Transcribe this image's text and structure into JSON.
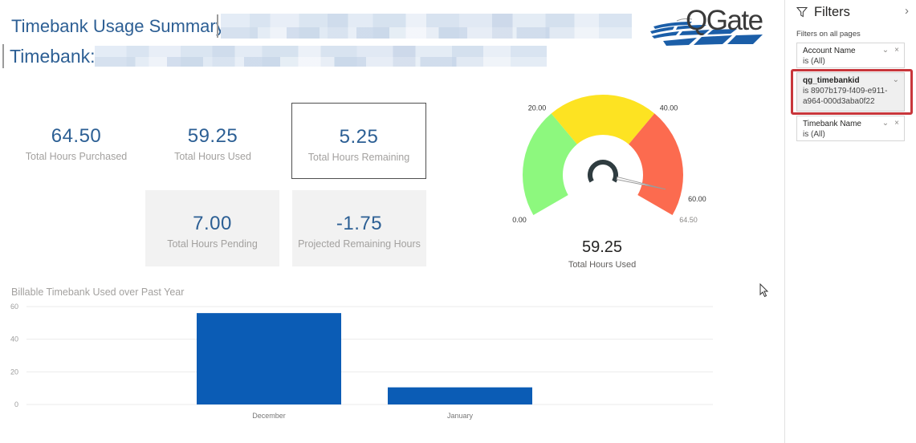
{
  "header": {
    "title": "Timebank Usage Summary",
    "timebank_label": "Timebank:",
    "logo_text": "QGate",
    "accent_color": "#2d5f94"
  },
  "kpis": [
    {
      "value": "64.50",
      "label": "Total Hours Purchased"
    },
    {
      "value": "59.25",
      "label": "Total Hours Used"
    },
    {
      "value": "5.25",
      "label": "Total Hours Remaining"
    },
    {
      "value": "7.00",
      "label": "Total Hours Pending"
    },
    {
      "value": "-1.75",
      "label": "Projected Remaining Hours"
    }
  ],
  "gauge": {
    "value": 59.25,
    "value_label": "59.25",
    "label": "Total Hours Used",
    "min": 0,
    "max": 64.5,
    "ranges": [
      {
        "from": 0,
        "to": 20,
        "color": "#8df87e"
      },
      {
        "from": 20,
        "to": 40,
        "color": "#fde322"
      },
      {
        "from": 40,
        "to": 64.5,
        "color": "#fc6b4f"
      }
    ],
    "ticks": [
      {
        "value": 0,
        "label": "0.00"
      },
      {
        "value": 20,
        "label": "20.00"
      },
      {
        "value": 40,
        "label": "40.00"
      },
      {
        "value": 60,
        "label": "60.00"
      },
      {
        "value": 64.5,
        "label": "64.50"
      }
    ]
  },
  "chart_data": {
    "type": "bar",
    "title": "Billable Timebank Used over Past Year",
    "categories": [
      "December",
      "January"
    ],
    "values": [
      56,
      10.5
    ],
    "xlabel": "",
    "ylabel": "",
    "ylim": [
      0,
      60
    ],
    "yticks": [
      0,
      20,
      40,
      60
    ],
    "grid": true,
    "legend": "none",
    "color": "#0b5cb5"
  },
  "filters": {
    "title": "Filters",
    "expand_icon": "›",
    "section_label": "Filters on all pages",
    "cards": [
      {
        "name": "Account Name",
        "condition": "is (All)"
      },
      {
        "name": "qg_timebankid",
        "condition": "is 8907b179-f409-e911-a964-000d3aba0f22"
      },
      {
        "name": "Timebank Name",
        "condition": "is (All)"
      }
    ],
    "chevron_icon": "⌄",
    "clear_icon": "×",
    "highlight_color": "#c8363b"
  }
}
